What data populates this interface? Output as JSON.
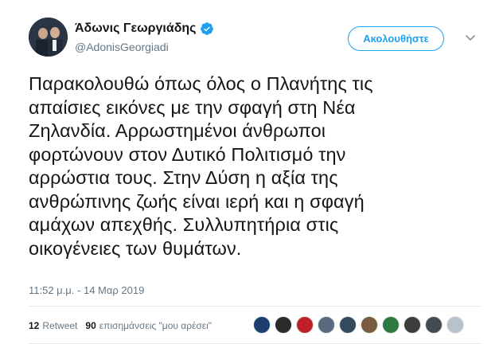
{
  "author": {
    "name": "Άδωνις Γεωργιάδης",
    "handle": "@AdonisGeorgiadi",
    "verified": true
  },
  "follow_button": {
    "label": "Ακολουθήστε"
  },
  "tweet": {
    "text": "Παρακολουθώ όπως όλος ο Πλανήτης τις\nαπαίσιες εικόνες με την σφαγή στη Νέα\nΖηλανδία. Αρρωστημένοι άνθρωποι\nφορτώνουν στον Δυτικό Πολιτισμό την\nαρρώστια τους. Στην Δύση η αξία της\nανθρώπινης ζωής είναι ιερή και η σφαγή\nαμάχων απεχθής. Συλλυπητήρια στις\nοικογένειες των θυμάτων.",
    "time": "11:52 μ.μ.",
    "separator": "-",
    "date": "14 Μαρ 2019"
  },
  "stats": {
    "retweets_count": "12",
    "retweets_label": "Retweet",
    "likes_count": "90",
    "likes_label": "επισημάνσεις \"μου αρέσει\""
  },
  "likers": [
    {
      "icon": "liker-avatar",
      "color": "#1c3f6e"
    },
    {
      "icon": "liker-avatar",
      "color": "#2b2b2b"
    },
    {
      "icon": "liker-avatar",
      "color": "#c0202a"
    },
    {
      "icon": "liker-avatar",
      "color": "#5a6b7d"
    },
    {
      "icon": "liker-avatar",
      "color": "#34495e"
    },
    {
      "icon": "liker-avatar",
      "color": "#7a5c3e"
    },
    {
      "icon": "liker-avatar",
      "color": "#2c7a3f"
    },
    {
      "icon": "liker-avatar",
      "color": "#3d3d3d"
    },
    {
      "icon": "liker-avatar",
      "color": "#444b52"
    },
    {
      "icon": "liker-avatar",
      "color": "#b8c2cc"
    }
  ],
  "colors": {
    "accent": "#1da1f2",
    "text": "#14171a",
    "secondary": "#657786",
    "divider": "#e6ecf0"
  }
}
